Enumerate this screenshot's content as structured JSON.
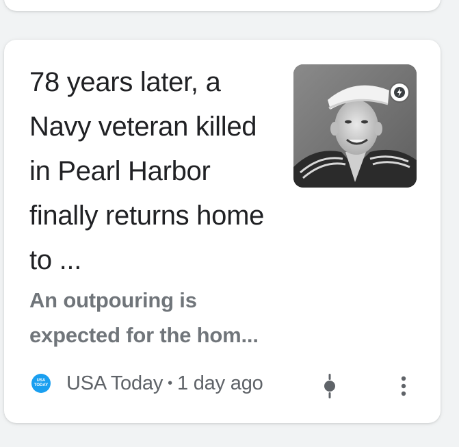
{
  "article": {
    "headline": "78 years later, a Navy veteran killed in Pearl Harbor finally returns home to ...",
    "snippet": "An outpouring is expected for the hom...",
    "thumbnail_icon": "sailor-portrait-photo",
    "badge_icon": "amp-lightning-icon"
  },
  "meta": {
    "source_logo_line1": "USA",
    "source_logo_line2": "TODAY",
    "source_name": "USA Today",
    "separator": "•",
    "time": "1 day ago",
    "follow_icon": "follow-indicator-icon",
    "more_icon": "more-vert-icon"
  },
  "colors": {
    "background": "#f1f3f4",
    "card": "#ffffff",
    "headline": "#202124",
    "snippet": "#70757a",
    "meta": "#5f6368",
    "source_logo": "#1a9ff0"
  }
}
